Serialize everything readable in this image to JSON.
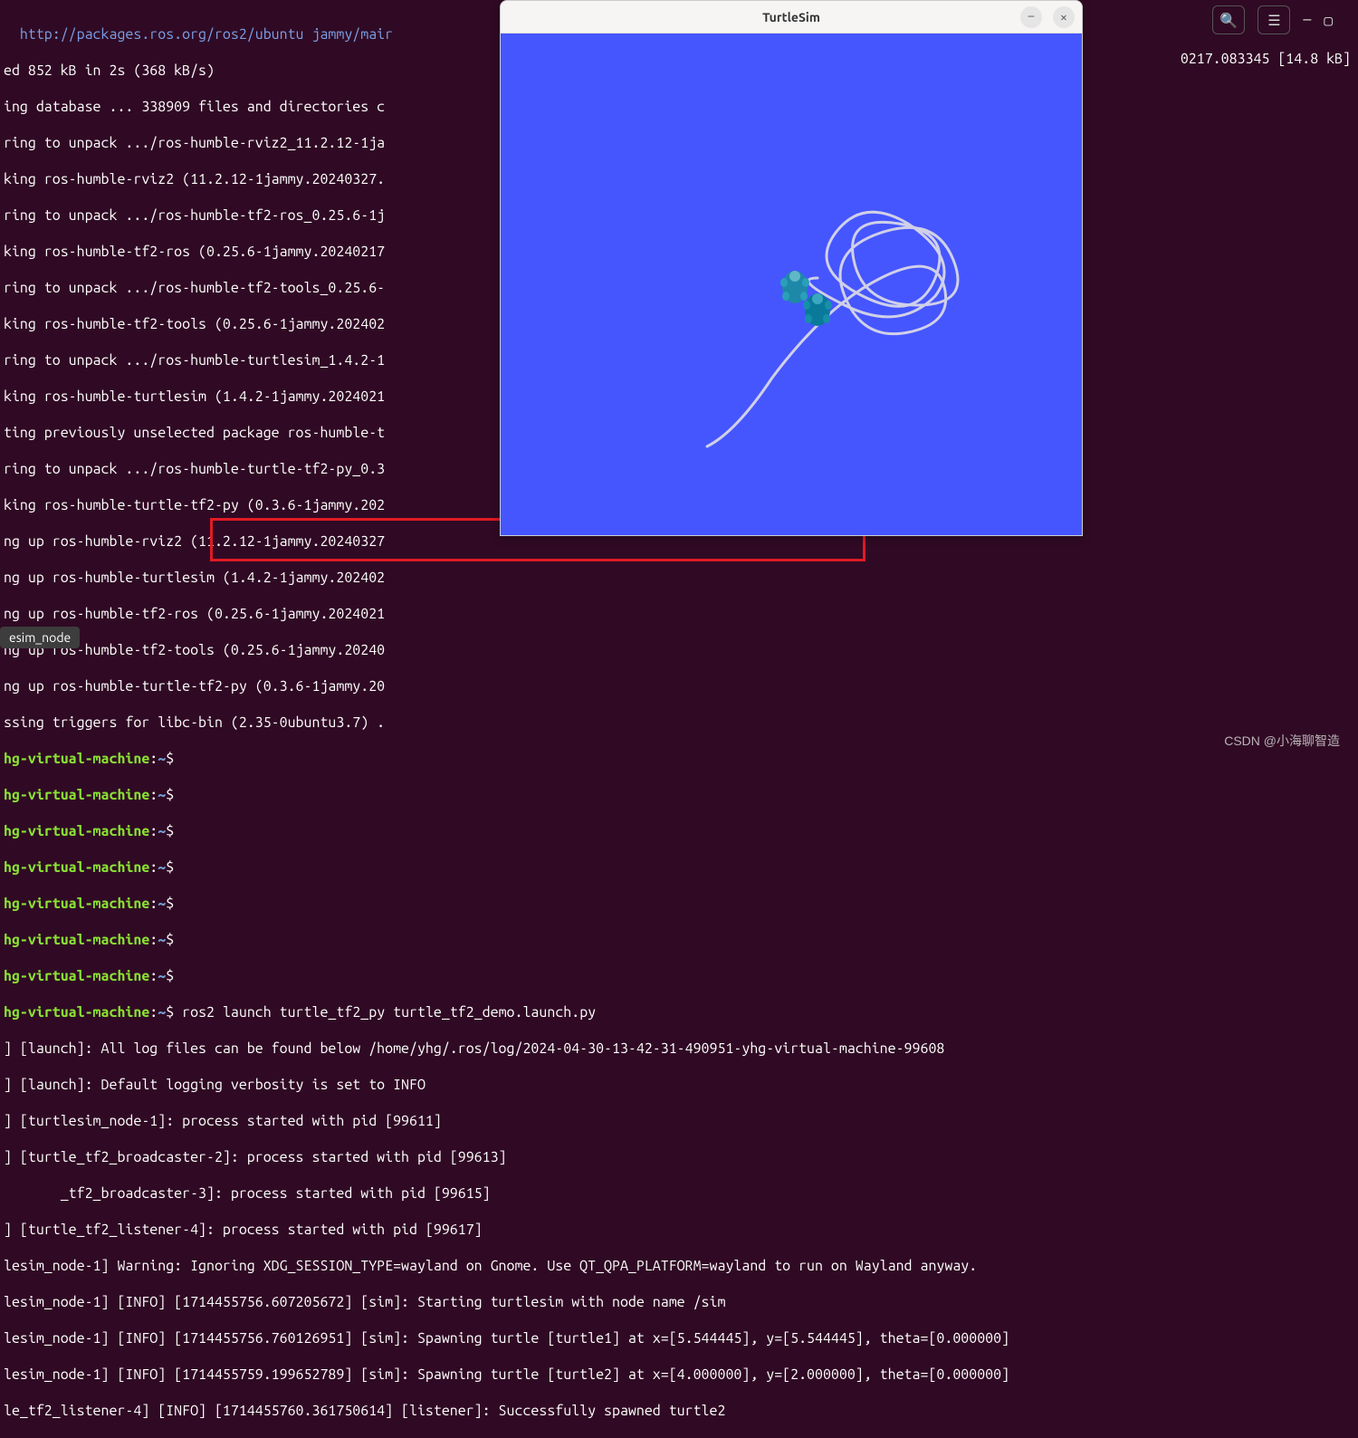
{
  "turtlesim": {
    "title": "TurtleSim"
  },
  "browser_right_text": "0217.083345 [14.8 kB]",
  "tooltip": "esim_node",
  "watermark": "CSDN @小海聊智造",
  "prompt": {
    "host": "hg-virtual-machine",
    "sep": ":",
    "path": "~",
    "dollar": "$"
  },
  "command": "ros2 launch turtle_tf2_py turtle_tf2_demo.launch.py",
  "terminal_lines": [
    "  http://packages.ros.org/ros2/ubuntu jammy/mair",
    "ed 852 kB in 2s (368 kB/s)",
    "ing database ... 338909 files and directories c",
    "ring to unpack .../ros-humble-rviz2_11.2.12-1ja",
    "king ros-humble-rviz2 (11.2.12-1jammy.20240327.",
    "ring to unpack .../ros-humble-tf2-ros_0.25.6-1j",
    "king ros-humble-tf2-ros (0.25.6-1jammy.20240217",
    "ring to unpack .../ros-humble-tf2-tools_0.25.6-",
    "king ros-humble-tf2-tools (0.25.6-1jammy.202402",
    "ring to unpack .../ros-humble-turtlesim_1.4.2-1",
    "king ros-humble-turtlesim (1.4.2-1jammy.2024021",
    "ting previously unselected package ros-humble-t",
    "ring to unpack .../ros-humble-turtle-tf2-py_0.3",
    "king ros-humble-turtle-tf2-py (0.3.6-1jammy.202",
    "ng up ros-humble-rviz2 (11.2.12-1jammy.20240327",
    "ng up ros-humble-turtlesim (1.4.2-1jammy.202402",
    "ng up ros-humble-tf2-ros (0.25.6-1jammy.2024021",
    "ng up ros-humble-tf2-tools (0.25.6-1jammy.20240",
    "ng up ros-humble-turtle-tf2-py (0.3.6-1jammy.20",
    "ssing triggers for libc-bin (2.35-0ubuntu3.7) ."
  ],
  "launch_lines": [
    "] [launch]: All log files can be found below /home/yhg/.ros/log/2024-04-30-13-42-31-490951-yhg-virtual-machine-99608",
    "] [launch]: Default logging verbosity is set to INFO",
    "] [turtlesim_node-1]: process started with pid [99611]",
    "] [turtle_tf2_broadcaster-2]: process started with pid [99613]",
    "       _tf2_broadcaster-3]: process started with pid [99615]",
    "] [turtle_tf2_listener-4]: process started with pid [99617]",
    "lesim_node-1] Warning: Ignoring XDG_SESSION_TYPE=wayland on Gnome. Use QT_QPA_PLATFORM=wayland to run on Wayland anyway.",
    "lesim_node-1] [INFO] [1714455756.607205672] [sim]: Starting turtlesim with node name /sim",
    "lesim_node-1] [INFO] [1714455756.760126951] [sim]: Spawning turtle [turtle1] at x=[5.544445], y=[5.544445], theta=[0.000000]",
    "lesim_node-1] [INFO] [1714455759.199652789] [sim]: Spawning turtle [turtle2] at x=[4.000000], y=[2.000000], theta=[0.000000]",
    "le_tf2_listener-4] [INFO] [1714455760.361750614] [listener]: Successfully spawned turtle2"
  ]
}
